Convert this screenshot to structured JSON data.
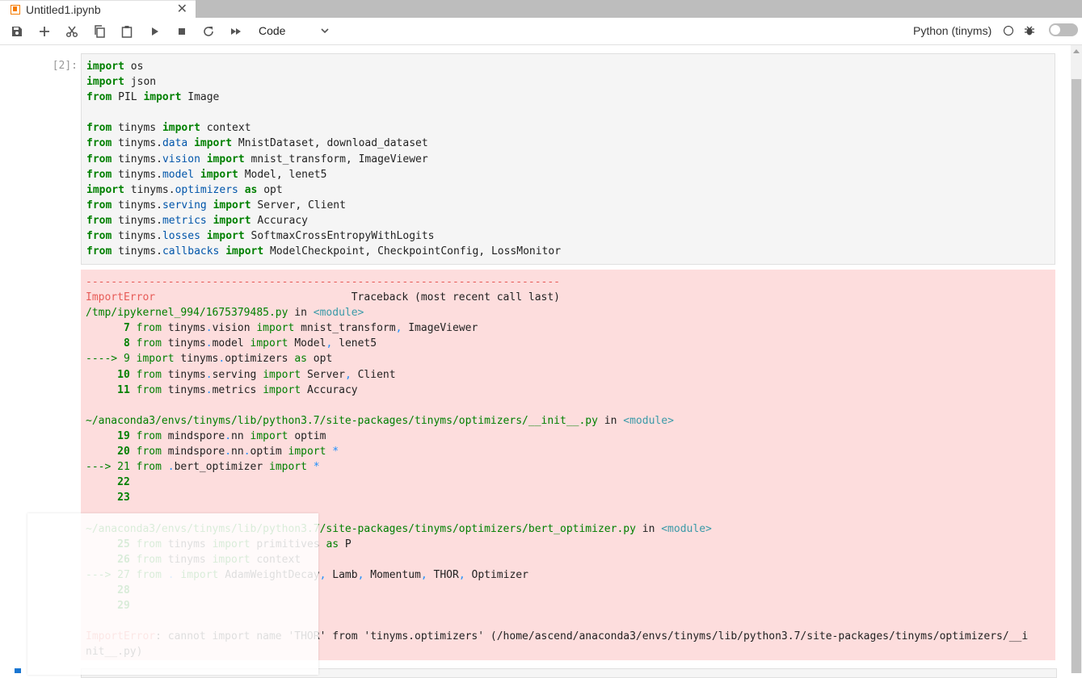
{
  "tab": {
    "title": "Untitled1.ipynb",
    "close": "✕"
  },
  "toolbar": {
    "cell_type": "Code",
    "kernel_name": "Python (tinyms)",
    "buttons": [
      "save-icon",
      "add-cell-icon",
      "cut-icon",
      "copy-icon",
      "paste-icon",
      "run-icon",
      "stop-icon",
      "restart-icon",
      "run-all-icon"
    ]
  },
  "cell": {
    "prompt": "[2]:",
    "code_lines": [
      [
        [
          "kw",
          "import"
        ],
        [
          "",
          "os"
        ]
      ],
      [
        [
          "kw",
          "import"
        ],
        [
          "",
          "json"
        ]
      ],
      [
        [
          "kw",
          "from"
        ],
        [
          "",
          "PIL "
        ],
        [
          "kw",
          "import"
        ],
        [
          "",
          "Image"
        ]
      ],
      [],
      [
        [
          "kw",
          "from"
        ],
        [
          "",
          "tinyms "
        ],
        [
          "kw",
          "import"
        ],
        [
          "",
          "context"
        ]
      ],
      [
        [
          "kw",
          "from"
        ],
        [
          "",
          "tinyms."
        ],
        [
          "mod",
          "data"
        ],
        [
          "",
          ""
        ],
        [
          "kw",
          "import"
        ],
        [
          "",
          "MnistDataset, download_dataset"
        ]
      ],
      [
        [
          "kw",
          "from"
        ],
        [
          "",
          "tinyms."
        ],
        [
          "mod",
          "vision"
        ],
        [
          "",
          ""
        ],
        [
          "kw",
          "import"
        ],
        [
          "",
          "mnist_transform, ImageViewer"
        ]
      ],
      [
        [
          "kw",
          "from"
        ],
        [
          "",
          "tinyms."
        ],
        [
          "mod",
          "model"
        ],
        [
          "",
          ""
        ],
        [
          "kw",
          "import"
        ],
        [
          "",
          "Model, lenet5"
        ]
      ],
      [
        [
          "kw",
          "import"
        ],
        [
          "",
          "tinyms."
        ],
        [
          "mod",
          "optimizers"
        ],
        [
          "",
          ""
        ],
        [
          "kw",
          "as"
        ],
        [
          "",
          "opt"
        ]
      ],
      [
        [
          "kw",
          "from"
        ],
        [
          "",
          "tinyms."
        ],
        [
          "mod",
          "serving"
        ],
        [
          "",
          ""
        ],
        [
          "kw",
          "import"
        ],
        [
          "",
          "Server, Client"
        ]
      ],
      [
        [
          "kw",
          "from"
        ],
        [
          "",
          "tinyms."
        ],
        [
          "mod",
          "metrics"
        ],
        [
          "",
          ""
        ],
        [
          "kw",
          "import"
        ],
        [
          "",
          "Accuracy"
        ]
      ],
      [
        [
          "kw",
          "from"
        ],
        [
          "",
          "tinyms."
        ],
        [
          "mod",
          "losses"
        ],
        [
          "",
          ""
        ],
        [
          "kw",
          "import"
        ],
        [
          "",
          "SoftmaxCrossEntropyWithLogits"
        ]
      ],
      [
        [
          "kw",
          "from"
        ],
        [
          "",
          "tinyms."
        ],
        [
          "mod",
          "callbacks"
        ],
        [
          "",
          ""
        ],
        [
          "kw",
          "import"
        ],
        [
          "",
          "ModelCheckpoint, CheckpointConfig, LossMonitor"
        ]
      ]
    ]
  },
  "traceback_lines": [
    [
      [
        "red",
        "---------------------------------------------------------------------------"
      ]
    ],
    [
      [
        "red",
        "ImportError"
      ],
      [
        "",
        "                               Traceback (most recent call last)"
      ]
    ],
    [
      [
        "green",
        "/tmp/ipykernel_994/1675379485.py"
      ],
      [
        "",
        " in "
      ],
      [
        "cyan",
        "<module>"
      ]
    ],
    [
      [
        "greenb",
        "      7 "
      ],
      [
        "green",
        "from"
      ],
      [
        "",
        " tinyms"
      ],
      [
        "blue",
        "."
      ],
      [
        "",
        "vision "
      ],
      [
        "green",
        "import"
      ],
      [
        "",
        " mnist_transform"
      ],
      [
        "blue",
        ","
      ],
      [
        "",
        " ImageViewer"
      ]
    ],
    [
      [
        "greenb",
        "      8 "
      ],
      [
        "green",
        "from"
      ],
      [
        "",
        " tinyms"
      ],
      [
        "blue",
        "."
      ],
      [
        "",
        "model "
      ],
      [
        "green",
        "import"
      ],
      [
        "",
        " Model"
      ],
      [
        "blue",
        ","
      ],
      [
        "",
        " lenet5"
      ]
    ],
    [
      [
        "green",
        "----> 9 "
      ],
      [
        "green",
        "import"
      ],
      [
        "",
        " tinyms"
      ],
      [
        "blue",
        "."
      ],
      [
        "",
        "optimizers "
      ],
      [
        "green",
        "as"
      ],
      [
        "",
        " opt"
      ]
    ],
    [
      [
        "greenb",
        "     10 "
      ],
      [
        "green",
        "from"
      ],
      [
        "",
        " tinyms"
      ],
      [
        "blue",
        "."
      ],
      [
        "",
        "serving "
      ],
      [
        "green",
        "import"
      ],
      [
        "",
        " Server"
      ],
      [
        "blue",
        ","
      ],
      [
        "",
        " Client"
      ]
    ],
    [
      [
        "greenb",
        "     11 "
      ],
      [
        "green",
        "from"
      ],
      [
        "",
        " tinyms"
      ],
      [
        "blue",
        "."
      ],
      [
        "",
        "metrics "
      ],
      [
        "green",
        "import"
      ],
      [
        "",
        " Accuracy"
      ]
    ],
    [],
    [
      [
        "green",
        "~/anaconda3/envs/tinyms/lib/python3.7/site-packages/tinyms/optimizers/__init__.py"
      ],
      [
        "",
        " in "
      ],
      [
        "cyan",
        "<module>"
      ]
    ],
    [
      [
        "greenb",
        "     19 "
      ],
      [
        "green",
        "from"
      ],
      [
        "",
        " mindspore"
      ],
      [
        "blue",
        "."
      ],
      [
        "",
        "nn "
      ],
      [
        "green",
        "import"
      ],
      [
        "",
        " optim"
      ]
    ],
    [
      [
        "greenb",
        "     20 "
      ],
      [
        "green",
        "from"
      ],
      [
        "",
        " mindspore"
      ],
      [
        "blue",
        "."
      ],
      [
        "",
        "nn"
      ],
      [
        "blue",
        "."
      ],
      [
        "",
        "optim "
      ],
      [
        "green",
        "import"
      ],
      [
        "blue",
        " *"
      ]
    ],
    [
      [
        "green",
        "---> 21 "
      ],
      [
        "green",
        "from"
      ],
      [
        "blue",
        " ."
      ],
      [
        "",
        "bert_optimizer "
      ],
      [
        "green",
        "import"
      ],
      [
        "blue",
        " *"
      ]
    ],
    [
      [
        "greenb",
        "     22"
      ]
    ],
    [
      [
        "greenb",
        "     23"
      ]
    ],
    [],
    [
      [
        "green",
        "~/anaconda3/envs/tinyms/lib/python3.7/site-packages/tinyms/optimizers/bert_optimizer.py"
      ],
      [
        "",
        " in "
      ],
      [
        "cyan",
        "<module>"
      ]
    ],
    [
      [
        "greenb",
        "     25 "
      ],
      [
        "green",
        "from"
      ],
      [
        "",
        " tinyms "
      ],
      [
        "green",
        "import"
      ],
      [
        "",
        " primitives "
      ],
      [
        "green",
        "as"
      ],
      [
        "",
        " P"
      ]
    ],
    [
      [
        "greenb",
        "     26 "
      ],
      [
        "green",
        "from"
      ],
      [
        "",
        " tinyms "
      ],
      [
        "green",
        "import"
      ],
      [
        "",
        " context"
      ]
    ],
    [
      [
        "green",
        "---> 27 "
      ],
      [
        "green",
        "from"
      ],
      [
        "blue",
        " ."
      ],
      [
        "",
        " "
      ],
      [
        "green",
        "import"
      ],
      [
        "",
        " AdamWeightDecay"
      ],
      [
        "blue",
        ","
      ],
      [
        "",
        " Lamb"
      ],
      [
        "blue",
        ","
      ],
      [
        "",
        " Momentum"
      ],
      [
        "blue",
        ","
      ],
      [
        "",
        " THOR"
      ],
      [
        "blue",
        ","
      ],
      [
        "",
        " Optimizer"
      ]
    ],
    [
      [
        "greenb",
        "     28"
      ]
    ],
    [
      [
        "greenb",
        "     29"
      ]
    ],
    [],
    [
      [
        "red",
        "ImportError"
      ],
      [
        "",
        ": cannot import name 'THOR' from 'tinyms.optimizers' (/home/ascend/anaconda3/envs/tinyms/lib/python3.7/site-packages/tinyms/optimizers/__i"
      ]
    ],
    [
      [
        "",
        "nit__.py)"
      ]
    ]
  ]
}
